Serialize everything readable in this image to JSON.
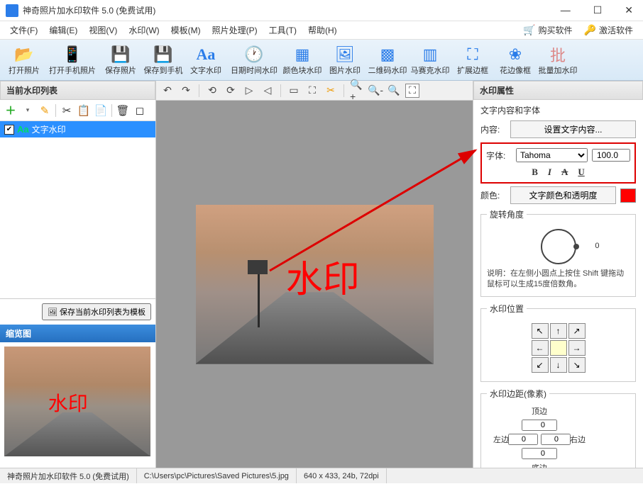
{
  "title": "神奇照片加水印软件 5.0 (免费试用)",
  "menubar": [
    "文件(F)",
    "编辑(E)",
    "视图(V)",
    "水印(W)",
    "模板(M)",
    "照片处理(P)",
    "工具(T)",
    "帮助(H)"
  ],
  "rightLinks": {
    "buy": "购买软件",
    "activate": "激活软件"
  },
  "toolbar": [
    {
      "id": "open-photo",
      "label": "打开照片",
      "icon": "📂",
      "cls": "ico-folder"
    },
    {
      "id": "open-phone",
      "label": "打开手机照片",
      "icon": "📱",
      "cls": "ico-phone",
      "wide": true
    },
    {
      "id": "save-photo",
      "label": "保存照片",
      "icon": "💾",
      "cls": "ico-save"
    },
    {
      "id": "save-phone",
      "label": "保存到手机",
      "icon": "💾",
      "cls": "ico-save"
    },
    {
      "id": "text-wm",
      "label": "文字水印",
      "icon": "Aa",
      "cls": "ico-aa"
    },
    {
      "id": "date-wm",
      "label": "日期时间水印",
      "icon": "🕐",
      "cls": "ico-clock",
      "wide": true
    },
    {
      "id": "block-wm",
      "label": "颜色块水印",
      "icon": "▦",
      "cls": "ico-block"
    },
    {
      "id": "image-wm",
      "label": "图片水印",
      "icon": "🖼",
      "cls": "ico-img"
    },
    {
      "id": "qr-wm",
      "label": "二维码水印",
      "icon": "▩",
      "cls": "ico-qr"
    },
    {
      "id": "mosaic-wm",
      "label": "马赛克水印",
      "icon": "▥",
      "cls": "ico-mosaic"
    },
    {
      "id": "expand-border",
      "label": "扩展边框",
      "icon": "⛶",
      "cls": "ico-expand"
    },
    {
      "id": "flower-border",
      "label": "花边像框",
      "icon": "❀",
      "cls": "ico-flower"
    },
    {
      "id": "batch-wm",
      "label": "批量加水印",
      "icon": "批",
      "cls": "ico-batch"
    }
  ],
  "leftPanel": {
    "listTitle": "当前水印列表",
    "item": "文字水印",
    "saveTemplate": "保存当前水印列表为模板",
    "previewTitle": "缩览图"
  },
  "watermarkText": "水印",
  "rightPanel": {
    "title": "水印属性",
    "group1": "文字内容和字体",
    "contentLabel": "内容:",
    "contentBtn": "设置文字内容...",
    "fontLabel": "字体:",
    "fontName": "Tahoma",
    "fontSize": "100.0",
    "colorLabel": "颜色:",
    "colorBtn": "文字颜色和透明度",
    "rotateLegend": "旋转角度",
    "rotateValue": "0",
    "rotateHint": "说明：在左侧小圆点上按住 Shift 键拖动鼠标可以生成15度倍数角。",
    "posLegend": "水印位置",
    "marginLegend": "水印边距(像素)",
    "marginTop": "顶边",
    "marginLeft": "左边",
    "marginRight": "右边",
    "marginBottom": "底边",
    "marginVal": "0"
  },
  "statusbar": {
    "app": "神奇照片加水印软件 5.0 (免费试用)",
    "path": "C:\\Users\\pc\\Pictures\\Saved Pictures\\5.jpg",
    "info": "640 x 433, 24b, 72dpi"
  }
}
